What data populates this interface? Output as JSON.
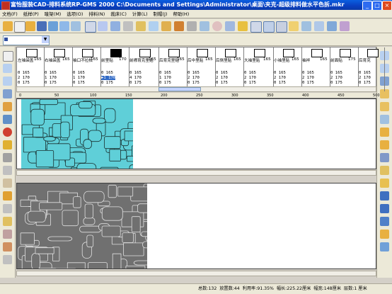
{
  "window": {
    "title": "富怡服装CAD-排料系统RP-GMS 2000 C:\\Documents and Settings\\Administrator\\桌面\\夹克-超级排料做水平色拆.mkr",
    "minimize": "_",
    "maximize": "□",
    "close": "×"
  },
  "menu": [
    "文档(F)",
    "纸样(P)",
    "唛架(M)",
    "选项(O)",
    "排料(N)",
    "裁床(C)",
    "计算(L)",
    "制帽(J)",
    "帮助(H)"
  ],
  "style_combo": {
    "value": "",
    "arrow": "▼"
  },
  "pieces": [
    {
      "label": "左袖袋盖",
      "size": "165",
      "rows": [
        "0  165",
        "2  170",
        "0  175"
      ]
    },
    {
      "label": "右袖袋盖",
      "size": "165",
      "rows": [
        "0  165",
        "1  170",
        "0  175"
      ]
    },
    {
      "label": "袖口不拉松",
      "size": "165",
      "rows": [
        "0  165",
        "1  170",
        "0  175"
      ]
    },
    {
      "label": "前里贴",
      "size": "170",
      "rows": [
        "0  165",
        "▶1  170",
        "0  175"
      ]
    },
    {
      "label": "前襟育克里贴",
      "size": "165",
      "rows": [
        "0  165",
        "4  170",
        "0  175"
      ]
    },
    {
      "label": "后育克里贴",
      "size": "165",
      "rows": [
        "0  165",
        "1  170",
        "0  175"
      ]
    },
    {
      "label": "后中里贴",
      "size": "165",
      "rows": [
        "0  165",
        "2  170",
        "0  175"
      ]
    },
    {
      "label": "后侧里贴",
      "size": "165",
      "rows": [
        "0  165",
        "2  170",
        "0  175"
      ]
    },
    {
      "label": "大袖里贴",
      "size": "165",
      "rows": [
        "0  165",
        "2  170",
        "0  175"
      ]
    },
    {
      "label": "小袖里贴",
      "size": "165",
      "rows": [
        "0  165",
        "2  170",
        "0  175"
      ]
    },
    {
      "label": "袖袢",
      "size": "165",
      "rows": [
        "0  165",
        "2  170",
        "0  175"
      ]
    },
    {
      "label": "前面贴",
      "size": "175",
      "rows": [
        "0  165",
        "2  170",
        "0  175"
      ]
    },
    {
      "label": "后育克",
      "size": "",
      "rows": [
        "0  165",
        "2  170",
        "0  175"
      ]
    }
  ],
  "ruler_ticks": [
    "0",
    "50",
    "100",
    "150",
    "200",
    "250",
    "300",
    "350",
    "400",
    "450",
    "500"
  ],
  "status": {
    "total_label": "总数:",
    "total": "132",
    "placed_label": "放置数:",
    "placed": "44",
    "util_label": "利用率:",
    "util": "91.35%",
    "length_label": "幅长:",
    "length": "225.22厘米",
    "width_label": "幅宽:",
    "width": "148厘米",
    "layers_label": "层数:",
    "layers": "1",
    "unit": "厘米"
  },
  "colors": {
    "piece_teal": "#5fcfd8",
    "piece_gray": "#707070",
    "titlebar": "#0a3fc0"
  }
}
